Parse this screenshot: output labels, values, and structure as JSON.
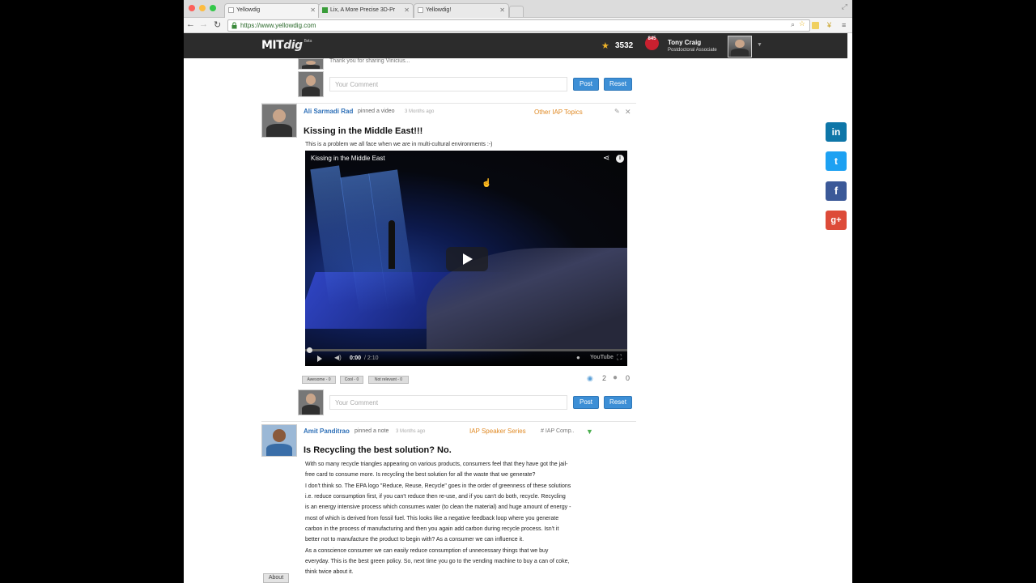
{
  "browser": {
    "tabs": [
      {
        "title": "Yellowdig",
        "active": true
      },
      {
        "title": "Lix, A More Precise 3D-Pr",
        "active": false
      },
      {
        "title": "Yellowdig!",
        "active": false
      }
    ],
    "url": "https://www.yellowdig.com"
  },
  "header": {
    "logo_main": "MIT",
    "logo_dig": "dig",
    "logo_beta": "Beta",
    "points": "3532",
    "notification_count": "845",
    "user_name": "Tony Craig",
    "user_role": "Postdoctoral Associate"
  },
  "feed": {
    "previous_comment": "Thank you for sharing Vinicius...",
    "comment_placeholder": "Your Comment",
    "post_label": "Post",
    "reset_label": "Reset",
    "post1": {
      "author": "Ali Sarmadi Rad",
      "action": "pinned a video",
      "time": "3 Months ago",
      "topic": "Other IAP Topics",
      "title": "Kissing in the Middle East!!!",
      "description": "This is a problem we all face when we are in multi-cultural environments :-)",
      "video": {
        "title": "Kissing in the Middle East",
        "time_current": "0:00",
        "time_total": " / 2:10",
        "progress": 0.0,
        "youtube_label": "YouTube"
      },
      "reactions": [
        "Awesome - 0",
        "Cool - 0",
        "Not relevant - 0"
      ],
      "views": "2",
      "comments": "0"
    },
    "post2": {
      "author": "Amit Panditrao",
      "action": "pinned a note",
      "time": "3 Months ago",
      "topic": "IAP Speaker Series",
      "hashtag": "# IAP Comp..",
      "title": "Is Recycling the best solution? No.",
      "body": [
        "With so many recycle triangles appearing on various products, consumers feel that they have got the jail-",
        "free card to consume more. Is recycling the best solution for all the waste that we generate?",
        "I don't think so. The EPA logo \"Reduce, Reuse, Recycle\" goes in the order of greenness of these solutions",
        "i.e. reduce consumption first, if you can't reduce then re-use, and if you can't do both, recycle. Recycling",
        "is an energy intensive process which consumes water (to clean the material) and huge amount of energy -",
        "most of which is derived from fossil fuel. This looks like a negative feedback loop where you generate",
        "carbon in the process of manufacturing and then you again add carbon during recycle process. Isn't it",
        "better not to manufacture the product to begin with? As a consumer we can influence it.",
        "As a conscience consumer we can easily reduce consumption of unnecessary things that we buy",
        "everyday. This is the best green policy. So, next time you go to the vending machine to buy a can of coke,",
        "think twice about it."
      ]
    }
  },
  "footer": {
    "about": "About"
  },
  "social": {
    "linkedin": "in",
    "twitter": "t",
    "facebook": "f",
    "googleplus": "g+"
  },
  "colors": {
    "accent": "#3d8fd6",
    "topic": "#e08a25",
    "author": "#2d6fb7",
    "header": "#2c2c2c"
  }
}
